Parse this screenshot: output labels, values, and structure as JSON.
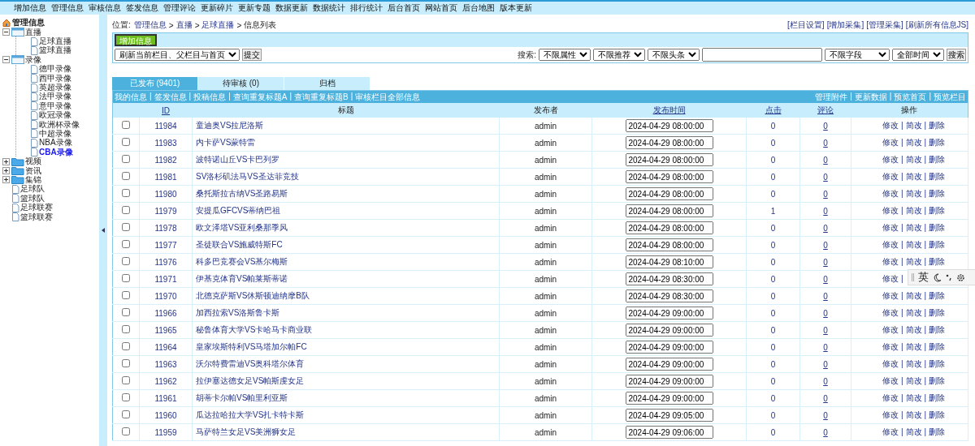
{
  "top_nav": [
    "增加信息",
    "管理信息",
    "审核信息",
    "签发信息",
    "管理评论",
    "更新碎片",
    "更新专题",
    "数据更新",
    "数据统计",
    "排行统计",
    "后台首页",
    "网站首页",
    "后台地图",
    "版本更新"
  ],
  "sidebar": {
    "title": "管理信息",
    "items": [
      {
        "label": "直播",
        "kind": "folder",
        "expanded": true,
        "selected": false,
        "children": [
          {
            "label": "足球直播",
            "kind": "page",
            "selected": false
          },
          {
            "label": "篮球直播",
            "kind": "page",
            "selected": false
          }
        ]
      },
      {
        "label": "录像",
        "kind": "folder",
        "expanded": true,
        "selected": false,
        "children": [
          {
            "label": "德甲录像",
            "kind": "page",
            "selected": false
          },
          {
            "label": "西甲录像",
            "kind": "page",
            "selected": false
          },
          {
            "label": "英超录像",
            "kind": "page",
            "selected": false
          },
          {
            "label": "法甲录像",
            "kind": "page",
            "selected": false
          },
          {
            "label": "意甲录像",
            "kind": "page",
            "selected": false
          },
          {
            "label": "欧冠录像",
            "kind": "page",
            "selected": false
          },
          {
            "label": "欧洲杯录像",
            "kind": "page",
            "selected": false
          },
          {
            "label": "中超录像",
            "kind": "page",
            "selected": false
          },
          {
            "label": "NBA录像",
            "kind": "page",
            "selected": false
          },
          {
            "label": "CBA录像",
            "kind": "page",
            "selected": true
          }
        ]
      },
      {
        "label": "视频",
        "kind": "folder",
        "expanded": false,
        "selected": false
      },
      {
        "label": "资讯",
        "kind": "folder",
        "expanded": false,
        "selected": false
      },
      {
        "label": "集锦",
        "kind": "folder",
        "expanded": false,
        "selected": false
      },
      {
        "label": "足球队",
        "kind": "page",
        "selected": false
      },
      {
        "label": "篮球队",
        "kind": "page",
        "selected": false
      },
      {
        "label": "足球联赛",
        "kind": "page",
        "selected": false
      },
      {
        "label": "篮球联赛",
        "kind": "page",
        "selected": false
      }
    ]
  },
  "breadcrumb": {
    "label": "位置:",
    "parts": [
      "管理信息",
      ">",
      "直播",
      ">",
      "足球直播",
      ">"
    ],
    "current": "信息列表"
  },
  "top_links": [
    "[栏目设置]",
    "[增加采集]",
    "[管理采集]",
    "[刷新所有信息JS]"
  ],
  "add_button": "增加信息",
  "refresh_select": "刷新当前栏目、父栏目与首页",
  "submit_button": "提交",
  "search": {
    "label": "搜索:",
    "filters": [
      "不限属性",
      "不限推荐",
      "不限头条"
    ],
    "field_select": "不限字段",
    "time_select": "全部时间",
    "button": "搜索"
  },
  "tabs": [
    {
      "label": "已发布 (9401)",
      "selected": true
    },
    {
      "label": "待审核 (0)",
      "selected": false
    },
    {
      "label": "归档",
      "selected": false
    }
  ],
  "left_links": [
    "我的信息",
    "|",
    "签发信息",
    "|",
    "投稿信息",
    "|",
    "查询重复标题A",
    "|",
    "查询重复标题B",
    "|",
    "审核栏目全部信息"
  ],
  "right_links": [
    "管理附件",
    "|",
    "更新数据",
    "|",
    "预览首页",
    "|",
    "预览栏目"
  ],
  "table": {
    "columns": [
      {
        "label": "ID",
        "sortable": true
      },
      {
        "label": "标题",
        "sortable": false
      },
      {
        "label": "发布者",
        "sortable": false
      },
      {
        "label": "发布时间",
        "sortable": true
      },
      {
        "label": "点击",
        "sortable": true
      },
      {
        "label": "评论",
        "sortable": true
      },
      {
        "label": "操作",
        "sortable": false
      }
    ],
    "rows": [
      {
        "checked": false,
        "id": "11984",
        "title": "童迪奥VS拉尼洛斯",
        "publisher": "admin",
        "time": "2024-04-29 08:00:00",
        "clicks": "0",
        "comments": "0",
        "actions": [
          "修改",
          "|",
          "简改",
          "|",
          "删除"
        ]
      },
      {
        "checked": false,
        "id": "11983",
        "title": "内卡萨VS蒙特雷",
        "publisher": "admin",
        "time": "2024-04-29 08:00:00",
        "clicks": "0",
        "comments": "0",
        "actions": [
          "修改",
          "|",
          "简改",
          "|",
          "删除"
        ]
      },
      {
        "checked": false,
        "id": "11982",
        "title": "波特诺山丘VS卡巴列罗",
        "publisher": "admin",
        "time": "2024-04-29 08:00:00",
        "clicks": "0",
        "comments": "0",
        "actions": [
          "修改",
          "|",
          "简改",
          "|",
          "删除"
        ]
      },
      {
        "checked": false,
        "id": "11981",
        "title": "SV洛杉矶法马VS圣达菲竞技",
        "publisher": "admin",
        "time": "2024-04-29 08:00:00",
        "clicks": "0",
        "comments": "0",
        "actions": [
          "修改",
          "|",
          "简改",
          "|",
          "删除"
        ]
      },
      {
        "checked": false,
        "id": "11980",
        "title": "桑托斯拉古纳VS圣路易斯",
        "publisher": "admin",
        "time": "2024-04-29 08:00:00",
        "clicks": "0",
        "comments": "0",
        "actions": [
          "修改",
          "|",
          "简改",
          "|",
          "删除"
        ]
      },
      {
        "checked": false,
        "id": "11979",
        "title": "安提瓜GFCVS蒂纳巴祖",
        "publisher": "admin",
        "time": "2024-04-29 08:00:00",
        "clicks": "1",
        "comments": "0",
        "actions": [
          "修改",
          "|",
          "简改",
          "|",
          "删除"
        ]
      },
      {
        "checked": false,
        "id": "11978",
        "title": "欧文泽塔VS亚利桑那季风",
        "publisher": "admin",
        "time": "2024-04-29 08:00:00",
        "clicks": "0",
        "comments": "0",
        "actions": [
          "修改",
          "|",
          "简改",
          "|",
          "删除"
        ]
      },
      {
        "checked": false,
        "id": "11977",
        "title": "圣徒联合VS施威特斯FC",
        "publisher": "admin",
        "time": "2024-04-29 08:00:00",
        "clicks": "0",
        "comments": "0",
        "actions": [
          "修改",
          "|",
          "简改",
          "|",
          "删除"
        ]
      },
      {
        "checked": false,
        "id": "11976",
        "title": "科多巴竞赛会VS基尔梅斯",
        "publisher": "admin",
        "time": "2024-04-29 08:10:00",
        "clicks": "0",
        "comments": "0",
        "actions": [
          "修改",
          "|",
          "简改",
          "|",
          "删除"
        ]
      },
      {
        "checked": false,
        "id": "11971",
        "title": "伊基克体育VS帕莱斯蒂诺",
        "publisher": "admin",
        "time": "2024-04-29 08:30:00",
        "clicks": "0",
        "comments": "0",
        "actions": [
          "修改",
          "|"
        ]
      },
      {
        "checked": false,
        "id": "11970",
        "title": "北德克萨斯VS休斯顿迪纳摩B队",
        "publisher": "admin",
        "time": "2024-04-29 08:30:00",
        "clicks": "0",
        "comments": "0",
        "actions": [
          "修改",
          "|",
          "简改",
          "|",
          "删除"
        ]
      },
      {
        "checked": false,
        "id": "11966",
        "title": "加西拉索VS洛斯鲁卡斯",
        "publisher": "admin",
        "time": "2024-04-29 09:00:00",
        "clicks": "0",
        "comments": "0",
        "actions": [
          "修改",
          "|",
          "简改",
          "|",
          "删除"
        ]
      },
      {
        "checked": false,
        "id": "11965",
        "title": "秘鲁体育大学VS卡哈马卡商业联",
        "publisher": "admin",
        "time": "2024-04-29 09:00:00",
        "clicks": "0",
        "comments": "0",
        "actions": [
          "修改",
          "|",
          "简改",
          "|",
          "删除"
        ]
      },
      {
        "checked": false,
        "id": "11964",
        "title": "皇家埃斯特利VS马塔加尔帕FC",
        "publisher": "admin",
        "time": "2024-04-29 09:00:00",
        "clicks": "0",
        "comments": "0",
        "actions": [
          "修改",
          "|",
          "简改",
          "|",
          "删除"
        ]
      },
      {
        "checked": false,
        "id": "11963",
        "title": "沃尔特费雷迪VS奥科塔尔体育",
        "publisher": "admin",
        "time": "2024-04-29 09:00:00",
        "clicks": "0",
        "comments": "0",
        "actions": [
          "修改",
          "|",
          "简改",
          "|",
          "删除"
        ]
      },
      {
        "checked": false,
        "id": "11962",
        "title": "拉伊塞达德女足VS帕斯虔女足",
        "publisher": "admin",
        "time": "2024-04-29 09:00:00",
        "clicks": "0",
        "comments": "0",
        "actions": [
          "修改",
          "|",
          "简改",
          "|",
          "删除"
        ]
      },
      {
        "checked": false,
        "id": "11961",
        "title": "胡蒂卡尔帕VS帕里利亚斯",
        "publisher": "admin",
        "time": "2024-04-29 09:00:00",
        "clicks": "0",
        "comments": "0",
        "actions": [
          "修改",
          "|",
          "简改",
          "|",
          "删除"
        ]
      },
      {
        "checked": false,
        "id": "11960",
        "title": "瓜达拉哈拉大学VS扎卡特卡斯",
        "publisher": "admin",
        "time": "2024-04-29 09:05:00",
        "clicks": "0",
        "comments": "0",
        "actions": [
          "修改",
          "|",
          "简改",
          "|",
          "删除"
        ]
      },
      {
        "checked": false,
        "id": "11959",
        "title": "马萨特兰女足VS美洲狮女足",
        "publisher": "admin",
        "time": "2024-04-29 09:06:00",
        "clicks": "0",
        "comments": "0",
        "actions": [
          "修改",
          "|",
          "简改",
          "|",
          "删除"
        ]
      }
    ]
  },
  "ime_bar": {
    "label": "英"
  }
}
